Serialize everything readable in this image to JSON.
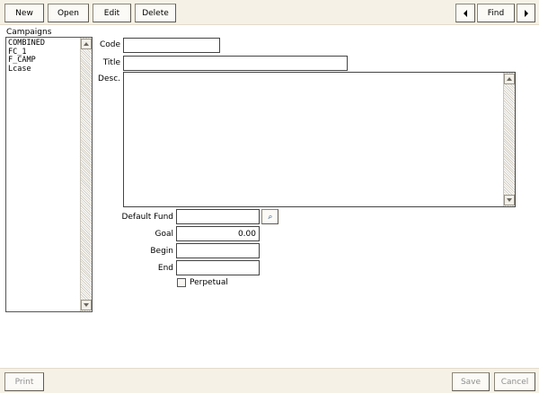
{
  "toolbar": {
    "new_label": "New",
    "open_label": "Open",
    "edit_label": "Edit",
    "delete_label": "Delete",
    "find_label": "Find"
  },
  "campaigns": {
    "label": "Campaigns",
    "items": [
      "COMBINED",
      "FC_1",
      "F_CAMP",
      "Lcase"
    ]
  },
  "form": {
    "code_label": "Code",
    "code_value": "",
    "title_label": "Title",
    "title_value": "",
    "desc_label": "Desc.",
    "desc_value": "",
    "default_fund_label": "Default Fund",
    "default_fund_value": "",
    "goal_label": "Goal",
    "goal_value": "0.00",
    "begin_label": "Begin",
    "begin_value": "",
    "end_label": "End",
    "end_value": "",
    "perpetual_label": "Perpetual",
    "perpetual_checked": false
  },
  "footer": {
    "print_label": "Print",
    "save_label": "Save",
    "cancel_label": "Cancel"
  },
  "icons": {
    "prev": "triangle-left-icon",
    "next": "triangle-right-icon",
    "lookup": "magnifier-icon"
  }
}
